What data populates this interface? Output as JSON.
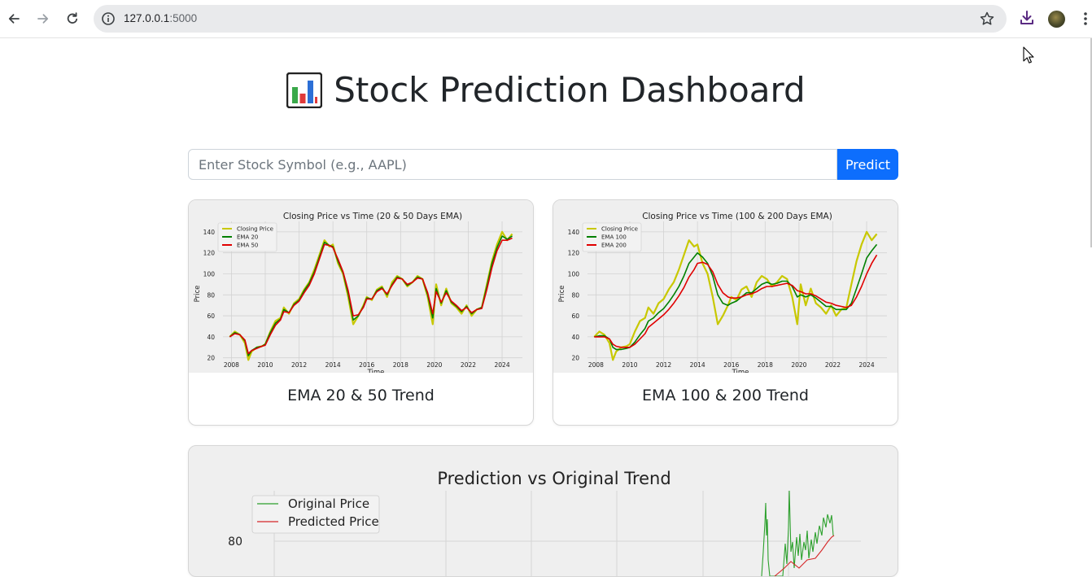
{
  "browser": {
    "url_host": "127.0.0.1",
    "url_port": ":5000"
  },
  "page": {
    "title": "Stock Prediction Dashboard",
    "search_placeholder": "Enter Stock Symbol (e.g., AAPL)",
    "predict_label": "Predict"
  },
  "cards": [
    {
      "caption": "EMA 20 & 50 Trend"
    },
    {
      "caption": "EMA 100 & 200 Trend"
    }
  ],
  "chart_data": [
    {
      "type": "line",
      "title": "Closing Price vs Time (20 & 50 Days EMA)",
      "xlabel": "Time",
      "ylabel": "Price",
      "x_ticks": [
        "2008",
        "2010",
        "2012",
        "2014",
        "2016",
        "2018",
        "2020",
        "2022",
        "2024"
      ],
      "y_ticks": [
        "20",
        "40",
        "60",
        "80",
        "100",
        "120",
        "140"
      ],
      "xlim": [
        2007.5,
        2025.2
      ],
      "ylim": [
        12,
        150
      ],
      "legend_position": "top-left",
      "grid": true,
      "x": [
        2007.9,
        2008.2,
        2008.5,
        2008.8,
        2009.0,
        2009.2,
        2009.5,
        2009.8,
        2010.0,
        2010.3,
        2010.6,
        2010.9,
        2011.1,
        2011.4,
        2011.7,
        2012.0,
        2012.3,
        2012.6,
        2012.9,
        2013.2,
        2013.5,
        2013.8,
        2014.0,
        2014.3,
        2014.6,
        2014.9,
        2015.2,
        2015.5,
        2015.8,
        2016.0,
        2016.3,
        2016.6,
        2016.9,
        2017.2,
        2017.5,
        2017.8,
        2018.1,
        2018.4,
        2018.7,
        2019.0,
        2019.3,
        2019.6,
        2019.9,
        2020.1,
        2020.4,
        2020.7,
        2021.0,
        2021.3,
        2021.6,
        2021.9,
        2022.2,
        2022.5,
        2022.8,
        2023.1,
        2023.4,
        2023.7,
        2024.0,
        2024.3,
        2024.6
      ],
      "series": [
        {
          "name": "Closing Price",
          "color": "#c8c800",
          "values": [
            40,
            45,
            42,
            34,
            18,
            26,
            30,
            31,
            33,
            45,
            55,
            58,
            68,
            62,
            72,
            76,
            85,
            92,
            104,
            118,
            132,
            126,
            128,
            110,
            100,
            78,
            52,
            60,
            70,
            78,
            75,
            85,
            88,
            78,
            92,
            98,
            95,
            88,
            92,
            98,
            95,
            78,
            52,
            90,
            70,
            86,
            72,
            68,
            62,
            70,
            60,
            66,
            68,
            90,
            112,
            128,
            140,
            132,
            138
          ]
        },
        {
          "name": "EMA 20",
          "color": "#008000",
          "values": [
            40,
            44,
            42,
            36,
            22,
            27,
            30,
            31,
            33,
            44,
            53,
            57,
            66,
            63,
            71,
            75,
            84,
            91,
            102,
            116,
            130,
            127,
            126,
            112,
            101,
            81,
            56,
            60,
            69,
            77,
            76,
            84,
            87,
            80,
            90,
            97,
            95,
            89,
            92,
            97,
            95,
            80,
            58,
            86,
            72,
            84,
            73,
            69,
            64,
            69,
            62,
            66,
            68,
            88,
            110,
            125,
            136,
            133,
            136
          ]
        },
        {
          "name": "EMA 50",
          "color": "#e00000",
          "values": [
            40,
            43,
            42,
            37,
            24,
            27,
            29,
            31,
            32,
            42,
            51,
            56,
            64,
            63,
            70,
            74,
            82,
            89,
            100,
            114,
            128,
            127,
            125,
            114,
            102,
            84,
            60,
            61,
            68,
            76,
            76,
            83,
            86,
            81,
            89,
            96,
            95,
            90,
            92,
            96,
            95,
            82,
            62,
            83,
            73,
            82,
            74,
            70,
            65,
            68,
            63,
            66,
            67,
            85,
            106,
            122,
            132,
            132,
            134
          ]
        }
      ]
    },
    {
      "type": "line",
      "title": "Closing Price vs Time (100 & 200 Days EMA)",
      "xlabel": "Time",
      "ylabel": "Price",
      "x_ticks": [
        "2008",
        "2010",
        "2012",
        "2014",
        "2016",
        "2018",
        "2020",
        "2022",
        "2024"
      ],
      "y_ticks": [
        "20",
        "40",
        "60",
        "80",
        "100",
        "120",
        "140"
      ],
      "xlim": [
        2007.5,
        2025.2
      ],
      "ylim": [
        12,
        150
      ],
      "legend_position": "top-left",
      "grid": true,
      "x": [
        2007.9,
        2008.2,
        2008.5,
        2008.8,
        2009.0,
        2009.2,
        2009.5,
        2009.8,
        2010.0,
        2010.3,
        2010.6,
        2010.9,
        2011.1,
        2011.4,
        2011.7,
        2012.0,
        2012.3,
        2012.6,
        2012.9,
        2013.2,
        2013.5,
        2013.8,
        2014.0,
        2014.3,
        2014.6,
        2014.9,
        2015.2,
        2015.5,
        2015.8,
        2016.0,
        2016.3,
        2016.6,
        2016.9,
        2017.2,
        2017.5,
        2017.8,
        2018.1,
        2018.4,
        2018.7,
        2019.0,
        2019.3,
        2019.6,
        2019.9,
        2020.1,
        2020.4,
        2020.7,
        2021.0,
        2021.3,
        2021.6,
        2021.9,
        2022.2,
        2022.5,
        2022.8,
        2023.1,
        2023.4,
        2023.7,
        2024.0,
        2024.3,
        2024.6
      ],
      "series": [
        {
          "name": "Closing Price",
          "color": "#c8c800",
          "values": [
            40,
            45,
            42,
            34,
            18,
            26,
            30,
            31,
            33,
            45,
            55,
            58,
            68,
            62,
            72,
            76,
            85,
            92,
            104,
            118,
            132,
            126,
            128,
            110,
            100,
            78,
            52,
            60,
            70,
            78,
            75,
            85,
            88,
            78,
            92,
            98,
            95,
            88,
            92,
            98,
            95,
            78,
            52,
            90,
            70,
            86,
            72,
            68,
            62,
            70,
            60,
            66,
            68,
            90,
            112,
            128,
            140,
            132,
            138
          ]
        },
        {
          "name": "EMA 100",
          "color": "#008000",
          "values": [
            40,
            41,
            41,
            38,
            30,
            28,
            28,
            29,
            30,
            35,
            42,
            48,
            55,
            58,
            63,
            67,
            73,
            80,
            88,
            98,
            110,
            116,
            120,
            116,
            110,
            98,
            80,
            72,
            70,
            72,
            74,
            78,
            82,
            82,
            86,
            90,
            92,
            90,
            91,
            93,
            93,
            88,
            78,
            80,
            78,
            80,
            77,
            73,
            69,
            69,
            66,
            66,
            66,
            72,
            86,
            100,
            115,
            122,
            128
          ]
        },
        {
          "name": "EMA 200",
          "color": "#e00000",
          "values": [
            40,
            40,
            40,
            38,
            33,
            31,
            30,
            30,
            30,
            33,
            38,
            43,
            49,
            53,
            57,
            61,
            66,
            72,
            79,
            87,
            97,
            104,
            110,
            111,
            109,
            102,
            90,
            82,
            78,
            77,
            77,
            78,
            80,
            81,
            83,
            86,
            88,
            88,
            89,
            90,
            91,
            89,
            84,
            83,
            81,
            81,
            79,
            76,
            73,
            72,
            70,
            69,
            68,
            70,
            78,
            88,
            100,
            110,
            118
          ]
        }
      ]
    },
    {
      "type": "line",
      "title": "Prediction vs Original Trend",
      "x_ticks": [],
      "y_ticks": [
        "80"
      ],
      "legend_position": "top-left",
      "grid": true,
      "series": [
        {
          "name": "Original Price",
          "color": "#2ca02c"
        },
        {
          "name": "Predicted Price",
          "color": "#d62728"
        }
      ]
    }
  ]
}
